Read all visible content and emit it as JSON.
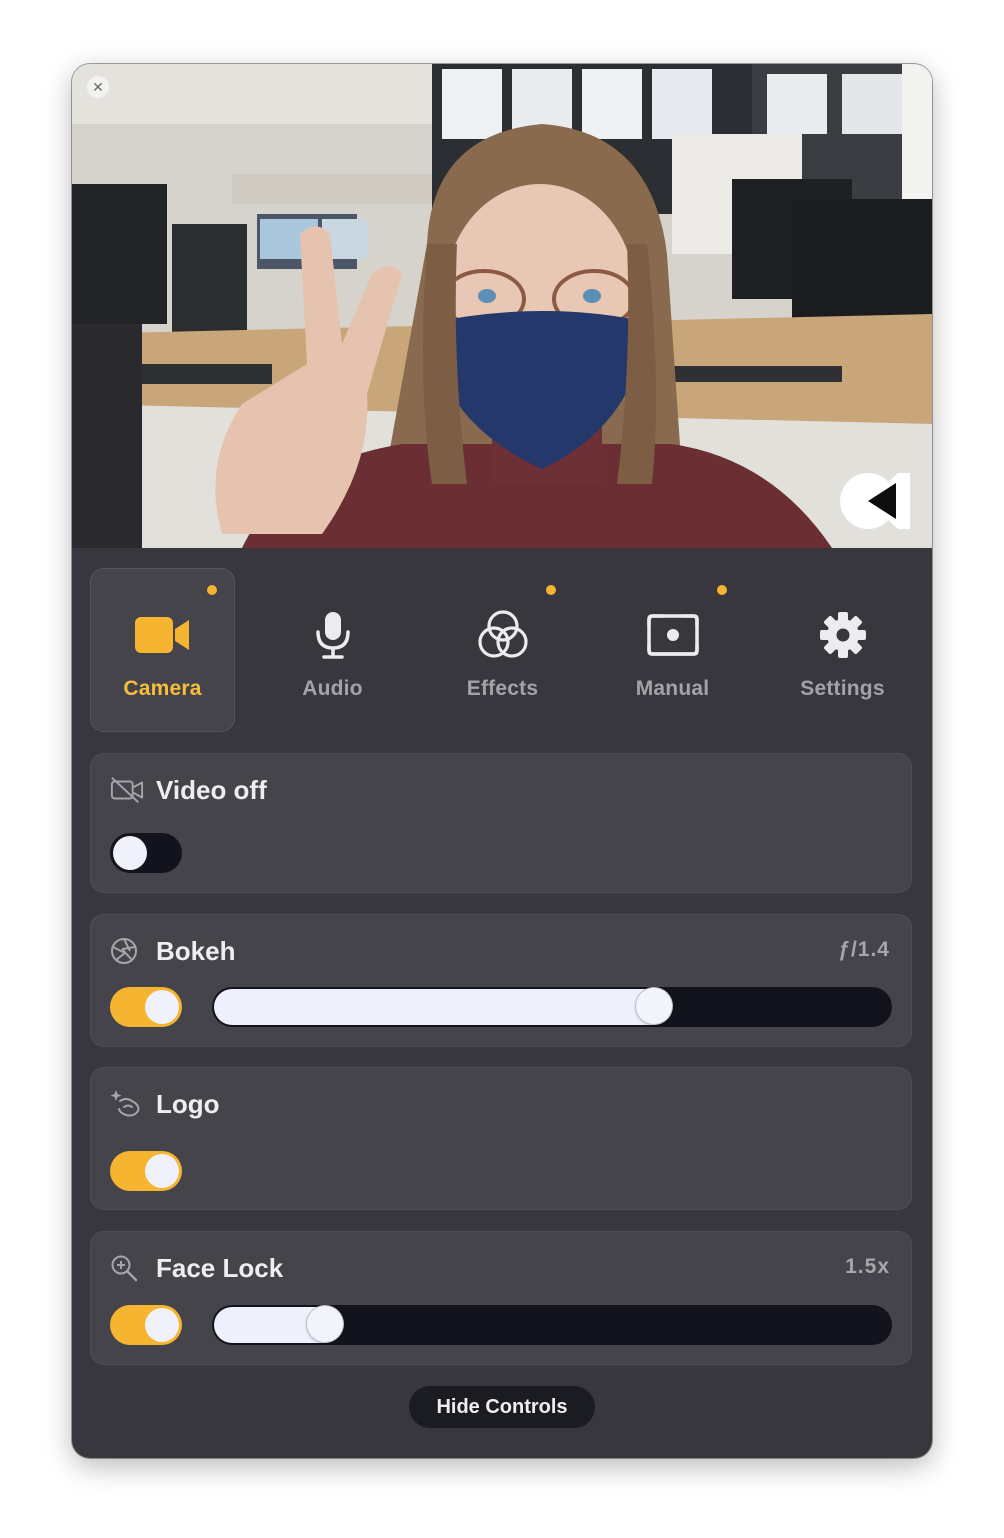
{
  "tabs": [
    {
      "label": "Camera",
      "icon": "video-camera-icon",
      "active": true,
      "has_dot": true
    },
    {
      "label": "Audio",
      "icon": "microphone-icon",
      "active": false,
      "has_dot": false
    },
    {
      "label": "Effects",
      "icon": "effects-circles-icon",
      "active": false,
      "has_dot": true
    },
    {
      "label": "Manual",
      "icon": "manual-focus-icon",
      "active": false,
      "has_dot": true
    },
    {
      "label": "Settings",
      "icon": "gear-icon",
      "active": false,
      "has_dot": false
    }
  ],
  "controls": {
    "video_off": {
      "label": "Video off",
      "enabled": false
    },
    "bokeh": {
      "label": "Bokeh",
      "value_text": "ƒ/1.4",
      "enabled": true,
      "level": 0.66
    },
    "logo": {
      "label": "Logo",
      "enabled": true
    },
    "face_lock": {
      "label": "Face Lock",
      "value_text": "1.5x",
      "enabled": true,
      "level": 0.145
    }
  },
  "hide_button": "Hide Controls",
  "colors": {
    "accent": "#f5b531",
    "panel_bg": "#45444b",
    "window_bg": "#38373e",
    "track_dark": "#12131c"
  }
}
